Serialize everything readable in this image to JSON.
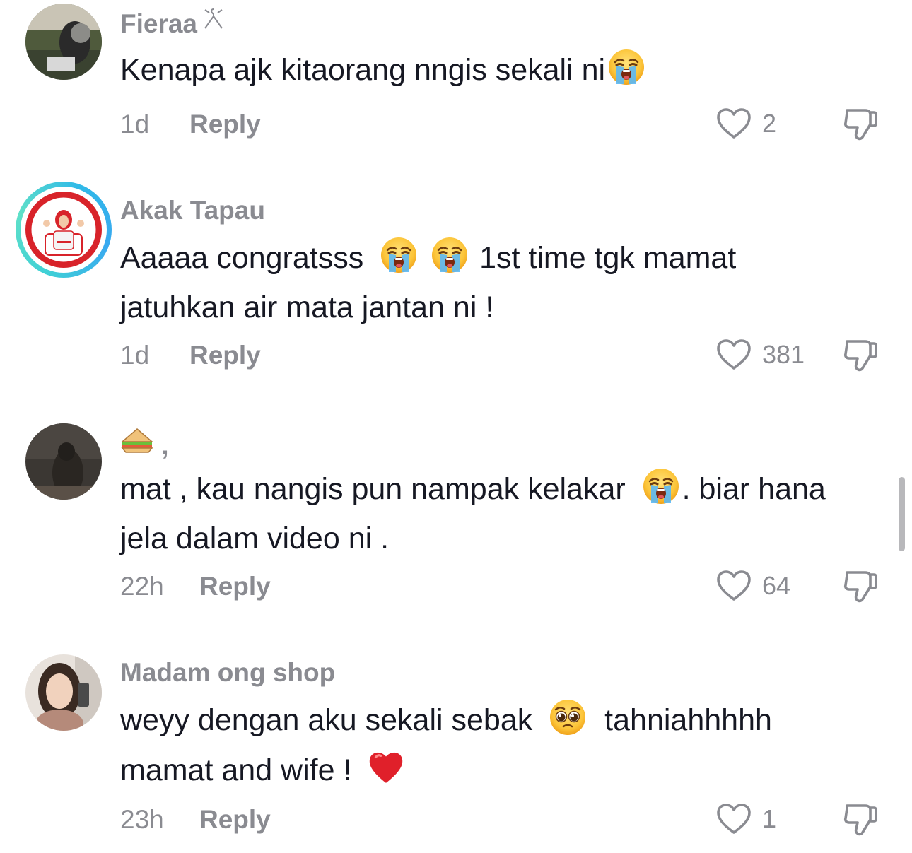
{
  "comments": [
    {
      "username": "Fieraa",
      "username_icon": "hanger-icon",
      "text_parts": [
        "Kenapa ajk kitaorang nngis sekali ni"
      ],
      "time": "1d",
      "reply_label": "Reply",
      "likes": "2"
    },
    {
      "username": "Akak Tapau",
      "text_line1_a": "Aaaaa congratsss",
      "text_line1_b": "1st time tgk mamat",
      "text_line2": "jatuhkan air mata jantan ni !",
      "time": "1d",
      "reply_label": "Reply",
      "likes": "381"
    },
    {
      "username_suffix": ",",
      "text_line1_a": "mat , kau nangis pun nampak kelakar",
      "text_line1_b": ". biar hana",
      "text_line2": "jela dalam video ni .",
      "time": "22h",
      "reply_label": "Reply",
      "likes": "64"
    },
    {
      "username": "Madam ong shop",
      "text_line1_a": "weyy dengan aku sekali sebak",
      "text_line1_b": "tahniahhhhh",
      "text_line2": "mamat and wife !",
      "time": "23h",
      "reply_label": "Reply",
      "likes": "1"
    }
  ],
  "icons": {
    "like": "heart-outline-icon",
    "dislike": "thumbs-down-icon",
    "crying": "loudly-crying-face-emoji",
    "pleading": "pleading-face-emoji",
    "heart": "red-heart-emoji",
    "sandwich": "sandwich-emoji"
  },
  "colors": {
    "text": "#161823",
    "secondary": "#8a8b91",
    "background": "#ffffff"
  }
}
